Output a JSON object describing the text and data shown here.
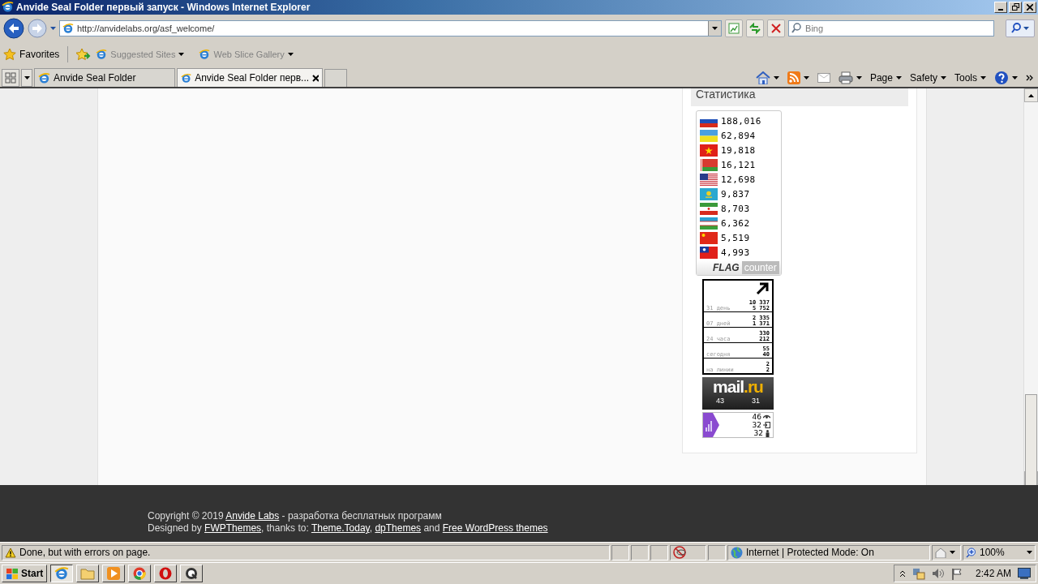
{
  "window": {
    "title": "Anvide Seal Folder первый запуск - Windows Internet Explorer"
  },
  "address_bar": {
    "url": "http://anvidelabs.org/asf_welcome/"
  },
  "search": {
    "placeholder": "Bing"
  },
  "favorites_bar": {
    "favorites": "Favorites",
    "items": [
      "Suggested Sites",
      "Web Slice Gallery"
    ]
  },
  "tabs": [
    {
      "label": "Anvide Seal Folder",
      "selected": false
    },
    {
      "label": "Anvide Seal Folder перв...",
      "selected": true
    }
  ],
  "command_bar": [
    "Page",
    "Safety",
    "Tools"
  ],
  "sidebar": {
    "heading": "Статистика",
    "flag_counter": {
      "rows": [
        {
          "kind": "ru",
          "count": "188,016"
        },
        {
          "kind": "ua",
          "count": "62,894"
        },
        {
          "kind": "vn",
          "count": "19,818"
        },
        {
          "kind": "by",
          "count": "16,121"
        },
        {
          "kind": "us",
          "count": "12,698"
        },
        {
          "kind": "kz",
          "count": "9,837"
        },
        {
          "kind": "ir",
          "count": "8,703"
        },
        {
          "kind": "uz",
          "count": "6,362"
        },
        {
          "kind": "cn",
          "count": "5,519"
        },
        {
          "kind": "tw",
          "count": "4,993"
        }
      ],
      "logo_bold": "FLAG",
      "logo_light": "counter"
    },
    "visit_counter": {
      "rows": [
        {
          "label": "31 день",
          "values": [
            "10 337",
            "5 752"
          ]
        },
        {
          "label": "07 дней",
          "values": [
            "2 335",
            "1 371"
          ]
        },
        {
          "label": "24 часа",
          "values": [
            "330",
            "212"
          ]
        },
        {
          "label": "сегодня",
          "values": [
            "55",
            "40"
          ]
        },
        {
          "label": "на линии",
          "values": [
            "2",
            "2"
          ]
        }
      ]
    },
    "mail_counter": {
      "logo": "mail",
      "logo_accent": ".ru",
      "values": [
        "43",
        "31"
      ]
    },
    "metrica": {
      "rows": [
        {
          "kind": "views",
          "value": "46"
        },
        {
          "kind": "visits",
          "value": "32"
        },
        {
          "kind": "visitors",
          "value": "32"
        }
      ]
    }
  },
  "footer": {
    "lines": [
      [
        {
          "kind": "text",
          "text": "Copyright © 2019 "
        },
        {
          "kind": "link",
          "text": "Anvide Labs"
        },
        {
          "kind": "text",
          "text": " - разработка бесплатных программ"
        }
      ],
      [
        {
          "kind": "text",
          "text": "Designed by "
        },
        {
          "kind": "link",
          "text": "FWPThemes"
        },
        {
          "kind": "text",
          "text": ", thanks to: "
        },
        {
          "kind": "link",
          "text": "Theme.Today"
        },
        {
          "kind": "text",
          "text": ", "
        },
        {
          "kind": "link",
          "text": "dpThemes"
        },
        {
          "kind": "text",
          "text": " and "
        },
        {
          "kind": "link",
          "text": "Free WordPress themes"
        }
      ]
    ]
  },
  "status_bar": {
    "message": "Done, but with errors on page.",
    "zone": "Internet | Protected Mode: On",
    "zoom": "100%"
  },
  "taskbar": {
    "start": "Start",
    "clock": "2:42 AM"
  }
}
